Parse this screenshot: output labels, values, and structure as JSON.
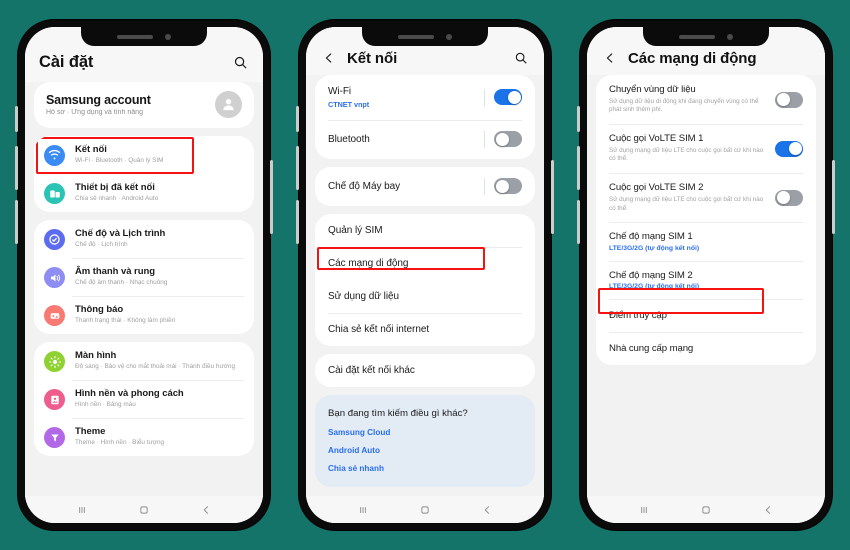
{
  "background_color": "#157469",
  "accent_blue": "#2a6ff0",
  "highlight_color": "#f41212",
  "phone1": {
    "appbar": {
      "title": "Cài đặt",
      "search_icon": "search-icon"
    },
    "account": {
      "name": "Samsung account",
      "subtitle": "Hồ sơ  ·  Ứng dụng và tính năng",
      "avatar_icon": "person-icon"
    },
    "group1": [
      {
        "title": "Kết nối",
        "subtitle": "Wi-Fi  ·  Bluetooth  ·  Quản lý SIM",
        "icon": "wifi-icon",
        "icon_color": "#3b8bf5",
        "highlighted": true
      },
      {
        "title": "Thiết bị đã kết nối",
        "subtitle": "Chia sẻ nhanh  ·  Android Auto",
        "icon": "devices-icon",
        "icon_color": "#2bc4b4"
      }
    ],
    "group2": [
      {
        "title": "Chế độ và Lịch trình",
        "subtitle": "Chế độ  ·  Lịch trình",
        "icon": "check-circle-icon",
        "icon_color": "#5c6bf0"
      },
      {
        "title": "Âm thanh và rung",
        "subtitle": "Chế độ âm thanh  ·  Nhạc chuông",
        "icon": "speaker-icon",
        "icon_color": "#8d8df4"
      },
      {
        "title": "Thông báo",
        "subtitle": "Thanh trạng thái  ·  Không làm phiền",
        "icon": "notification-icon",
        "icon_color": "#f87a72"
      }
    ],
    "group3": [
      {
        "title": "Màn hình",
        "subtitle": "Độ sáng  ·  Bảo vệ cho mắt thoải mái  ·  Thanh điều hướng",
        "icon": "brightness-icon",
        "icon_color": "#8ed130"
      },
      {
        "title": "Hình nền và phong cách",
        "subtitle": "Hình nền  ·  Bảng màu",
        "icon": "wallpaper-icon",
        "icon_color": "#ef5d8c"
      },
      {
        "title": "Theme",
        "subtitle": "Theme  ·  Hình nền  ·  Biểu tượng",
        "icon": "theme-icon",
        "icon_color": "#b269e8"
      }
    ],
    "navbar": {
      "recents": "recents-icon",
      "home": "home-icon",
      "back": "back-icon"
    }
  },
  "phone2": {
    "appbar": {
      "back_icon": "chevron-left-icon",
      "title": "Kết nối",
      "search_icon": "search-icon"
    },
    "group1": [
      {
        "label": "Wi-Fi",
        "sub": "CTNET vnpt",
        "toggle": "on"
      },
      {
        "label": "Bluetooth",
        "sub": "",
        "toggle": "off"
      }
    ],
    "group2": [
      {
        "label": "Chế độ Máy bay",
        "sub": "",
        "toggle": "off"
      }
    ],
    "group3": [
      {
        "label": "Quản lý SIM"
      },
      {
        "label": "Các mạng di động",
        "highlighted": true
      },
      {
        "label": "Sử dụng dữ liệu"
      },
      {
        "label": "Chia sẻ kết nối internet"
      }
    ],
    "group4": [
      {
        "label": "Cài đặt kết nối khác"
      }
    ],
    "lookcard": {
      "question": "Bạn đang tìm kiếm điều gì khác?",
      "links": [
        "Samsung Cloud",
        "Android Auto",
        "Chia sẻ nhanh"
      ]
    },
    "navbar": {
      "recents": "recents-icon",
      "home": "home-icon",
      "back": "back-icon"
    }
  },
  "phone3": {
    "appbar": {
      "back_icon": "chevron-left-icon",
      "title": "Các mạng di động"
    },
    "rows": [
      {
        "label": "Chuyển vùng dữ liệu",
        "desc": "Sử dụng dữ liệu di động khi đang chuyển vùng có thể phát sinh thêm phí.",
        "toggle": "off"
      },
      {
        "label": "Cuộc gọi VoLTE SIM 1",
        "desc": "Sử dụng mạng dữ liệu LTE cho cuộc gọi bất cứ khi nào có thể.",
        "toggle": "on"
      },
      {
        "label": "Cuộc gọi VoLTE SIM 2",
        "desc": "Sử dụng mạng dữ liệu LTE cho cuộc gọi bất cứ khi nào có thể.",
        "toggle": "off"
      },
      {
        "label": "Chế độ mạng SIM 1",
        "sub": "LTE/3G/2G (tự động kết nối)"
      },
      {
        "label": "Chế độ mạng SIM 2",
        "sub": "LTE/3G/2G (tự động kết nối)"
      },
      {
        "label": "Điểm truy cập",
        "highlighted": true
      },
      {
        "label": "Nhà cung cấp mạng"
      }
    ],
    "navbar": {
      "recents": "recents-icon",
      "home": "home-icon",
      "back": "back-icon"
    }
  }
}
